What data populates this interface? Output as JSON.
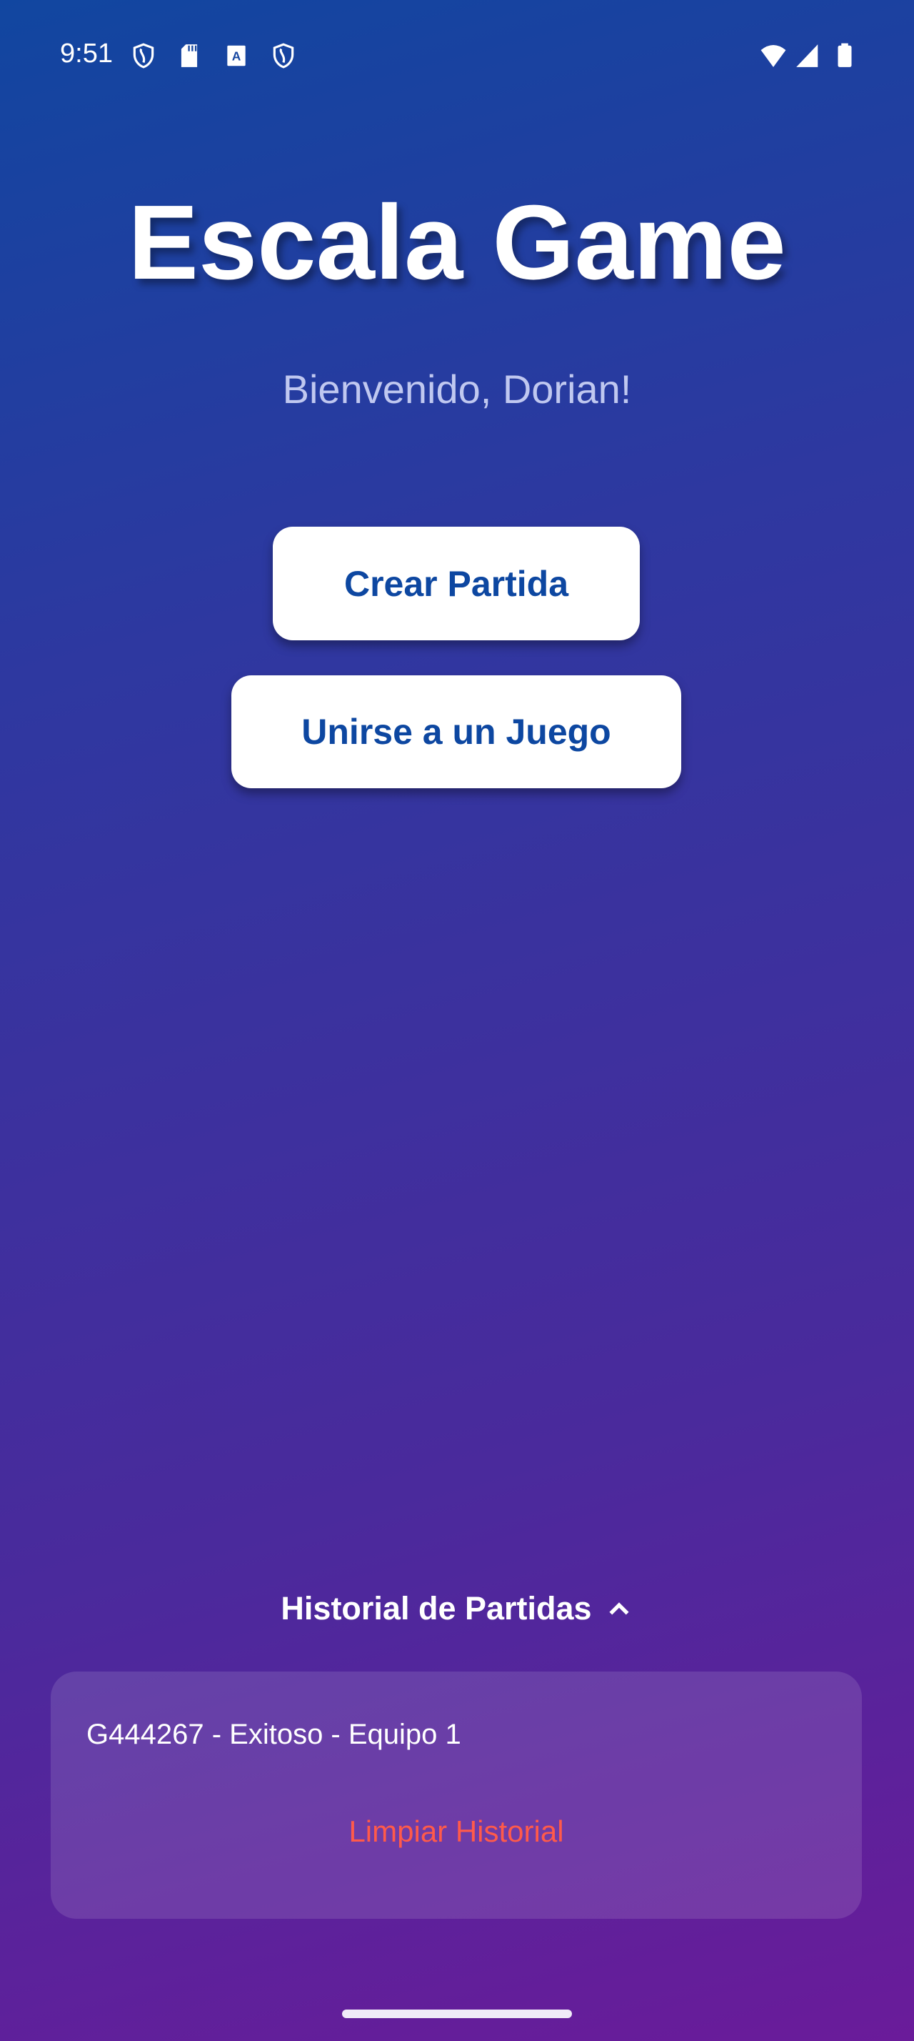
{
  "status_bar": {
    "time": "9:51",
    "left_icons": [
      "shield-icon",
      "sd-card-icon",
      "font-a-icon",
      "shield-icon"
    ],
    "right_icons": [
      "wifi-icon",
      "cell-signal-icon",
      "battery-icon"
    ]
  },
  "header": {
    "title": "Escala Game",
    "subtitle": "Bienvenido, Dorian!"
  },
  "actions": {
    "create_label": "Crear Partida",
    "join_label": "Unirse a un Juego"
  },
  "history": {
    "title": "Historial de Partidas",
    "toggle_icon": "chevron-up-icon",
    "items": [
      "G444267 - Exitoso - Equipo 1"
    ],
    "clear_label": "Limpiar Historial"
  },
  "colors": {
    "gradient_start": "#1146a0",
    "gradient_end": "#6a1b9a",
    "button_text": "#0d47a1",
    "clear_text": "#ff5a4a"
  }
}
